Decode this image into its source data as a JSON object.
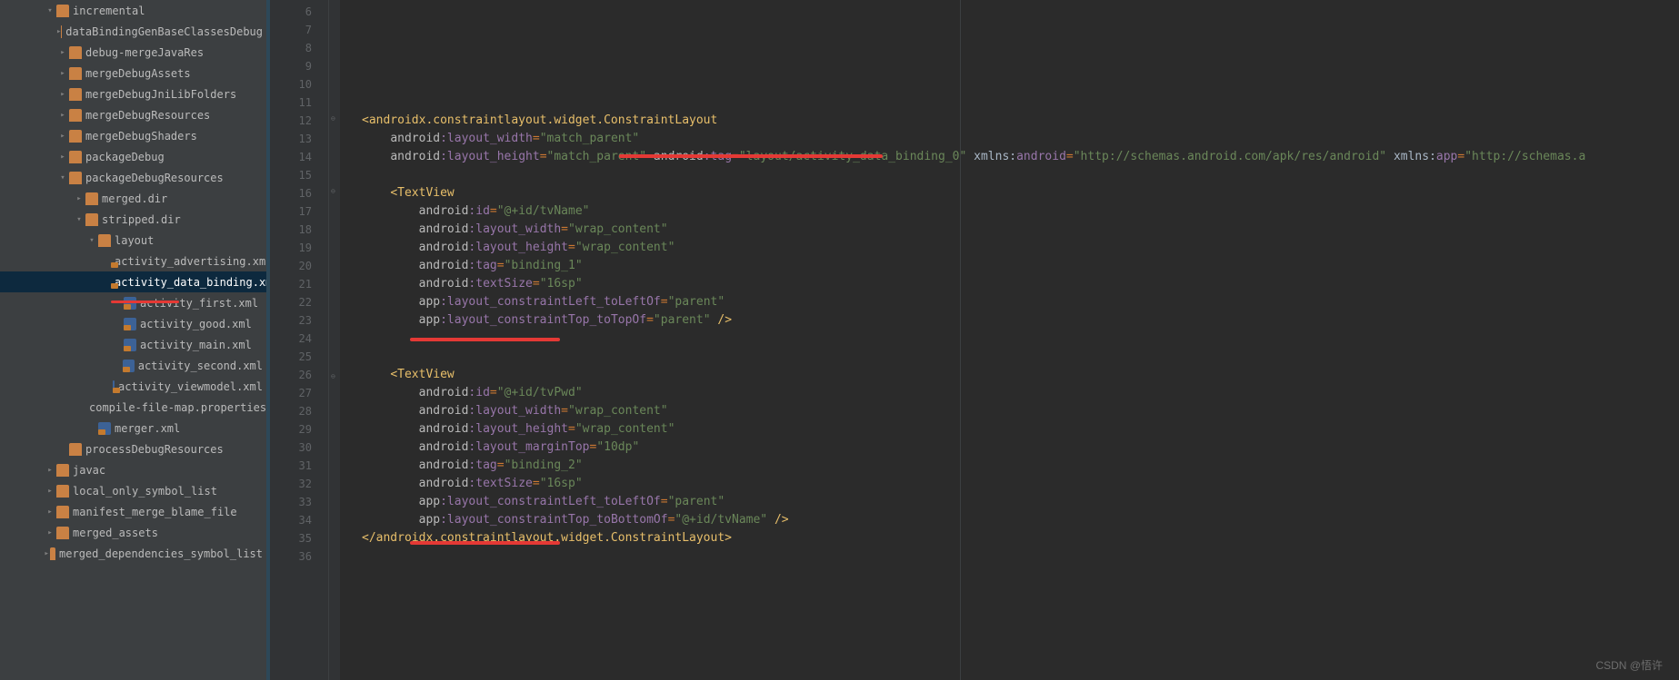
{
  "watermark": "CSDN @悟许",
  "tree": [
    {
      "indent": 48,
      "chevron": "down",
      "icon": "folder",
      "label": "incremental"
    },
    {
      "indent": 62,
      "chevron": "right",
      "icon": "folder",
      "label": "dataBindingGenBaseClassesDebug"
    },
    {
      "indent": 62,
      "chevron": "right",
      "icon": "folder",
      "label": "debug-mergeJavaRes"
    },
    {
      "indent": 62,
      "chevron": "right",
      "icon": "folder",
      "label": "mergeDebugAssets"
    },
    {
      "indent": 62,
      "chevron": "right",
      "icon": "folder",
      "label": "mergeDebugJniLibFolders"
    },
    {
      "indent": 62,
      "chevron": "right",
      "icon": "folder",
      "label": "mergeDebugResources"
    },
    {
      "indent": 62,
      "chevron": "right",
      "icon": "folder",
      "label": "mergeDebugShaders"
    },
    {
      "indent": 62,
      "chevron": "right",
      "icon": "folder",
      "label": "packageDebug"
    },
    {
      "indent": 62,
      "chevron": "down",
      "icon": "folder",
      "label": "packageDebugResources"
    },
    {
      "indent": 80,
      "chevron": "right",
      "icon": "folder",
      "label": "merged.dir"
    },
    {
      "indent": 80,
      "chevron": "down",
      "icon": "folder",
      "label": "stripped.dir"
    },
    {
      "indent": 94,
      "chevron": "down",
      "icon": "folder",
      "label": "layout"
    },
    {
      "indent": 122,
      "chevron": "",
      "icon": "file",
      "label": "activity_advertising.xml"
    },
    {
      "indent": 122,
      "chevron": "",
      "icon": "file",
      "label": "activity_data_binding.xml",
      "selected": true
    },
    {
      "indent": 122,
      "chevron": "",
      "icon": "file",
      "label": "activity_first.xml"
    },
    {
      "indent": 122,
      "chevron": "",
      "icon": "file",
      "label": "activity_good.xml"
    },
    {
      "indent": 122,
      "chevron": "",
      "icon": "file",
      "label": "activity_main.xml"
    },
    {
      "indent": 122,
      "chevron": "",
      "icon": "file",
      "label": "activity_second.xml"
    },
    {
      "indent": 122,
      "chevron": "",
      "icon": "file",
      "label": "activity_viewmodel.xml"
    },
    {
      "indent": 94,
      "chevron": "",
      "icon": "prop",
      "label": "compile-file-map.properties"
    },
    {
      "indent": 94,
      "chevron": "",
      "icon": "file",
      "label": "merger.xml"
    },
    {
      "indent": 62,
      "chevron": "",
      "icon": "folder",
      "label": "processDebugResources"
    },
    {
      "indent": 48,
      "chevron": "right",
      "icon": "folder",
      "label": "javac"
    },
    {
      "indent": 48,
      "chevron": "right",
      "icon": "folder",
      "label": "local_only_symbol_list"
    },
    {
      "indent": 48,
      "chevron": "right",
      "icon": "folder",
      "label": "manifest_merge_blame_file"
    },
    {
      "indent": 48,
      "chevron": "right",
      "icon": "folder",
      "label": "merged_assets"
    },
    {
      "indent": 48,
      "chevron": "right",
      "icon": "folder",
      "label": "merged_dependencies_symbol_list"
    }
  ],
  "line_numbers": [
    "6",
    "7",
    "8",
    "9",
    "10",
    "11",
    "12",
    "13",
    "14",
    "15",
    "16",
    "17",
    "18",
    "19",
    "20",
    "21",
    "22",
    "23",
    "24",
    "25",
    "26",
    "27",
    "28",
    "29",
    "30",
    "31",
    "32",
    "33",
    "34",
    "35",
    "36"
  ],
  "code": {
    "l12": {
      "tag_open": "<androidx.constraintlayout.widget.ConstraintLayout"
    },
    "l13": {
      "ns": "android",
      "attr": ":layout_width",
      "eq": "=",
      "val": "\"match_parent\""
    },
    "l14": {
      "ns": "android",
      "attr": ":layout_height",
      "eq": "=",
      "val": "\"match_parent\"",
      "sp": " ",
      "ns2": "android",
      "attr2": ":tag",
      "eq2": "=",
      "val2": "\"layout/activity_data_binding_0\"",
      "sp2": " ",
      "plain1": "xmlns:",
      "ns3": "android",
      "eq3": "=",
      "val3": "\"http://schemas.android.com/apk/res/android\"",
      "sp3": " ",
      "plain2": "xmlns:",
      "ns4": "app",
      "eq4": "=",
      "val4": "\"http://schemas.a"
    },
    "l16": {
      "tag_open": "<TextView"
    },
    "l17": {
      "ns": "android",
      "attr": ":id",
      "eq": "=",
      "val": "\"@+id/tvName\""
    },
    "l18": {
      "ns": "android",
      "attr": ":layout_width",
      "eq": "=",
      "val": "\"wrap_content\""
    },
    "l19": {
      "ns": "android",
      "attr": ":layout_height",
      "eq": "=",
      "val": "\"wrap_content\""
    },
    "l20": {
      "ns": "android",
      "attr": ":tag",
      "eq": "=",
      "val": "\"binding_1\""
    },
    "l21": {
      "ns": "android",
      "attr": ":textSize",
      "eq": "=",
      "val": "\"16sp\""
    },
    "l22": {
      "ns": "app",
      "attr": ":layout_constraintLeft_toLeftOf",
      "eq": "=",
      "val": "\"parent\""
    },
    "l23": {
      "ns": "app",
      "attr": ":layout_constraintTop_toTopOf",
      "eq": "=",
      "val": "\"parent\"",
      "close": " />"
    },
    "l26": {
      "tag_open": "<TextView"
    },
    "l27": {
      "ns": "android",
      "attr": ":id",
      "eq": "=",
      "val": "\"@+id/tvPwd\""
    },
    "l28": {
      "ns": "android",
      "attr": ":layout_width",
      "eq": "=",
      "val": "\"wrap_content\""
    },
    "l29": {
      "ns": "android",
      "attr": ":layout_height",
      "eq": "=",
      "val": "\"wrap_content\""
    },
    "l30": {
      "ns": "android",
      "attr": ":layout_marginTop",
      "eq": "=",
      "val": "\"10dp\""
    },
    "l31": {
      "ns": "android",
      "attr": ":tag",
      "eq": "=",
      "val": "\"binding_2\""
    },
    "l32": {
      "ns": "android",
      "attr": ":textSize",
      "eq": "=",
      "val": "\"16sp\""
    },
    "l33": {
      "ns": "app",
      "attr": ":layout_constraintLeft_toLeftOf",
      "eq": "=",
      "val": "\"parent\""
    },
    "l34": {
      "ns": "app",
      "attr": ":layout_constraintTop_toBottomOf",
      "eq": "=",
      "val": "\"@+id/tvName\"",
      "close": " />"
    },
    "l35": {
      "tag_close": "</androidx.constraintlayout.widget.ConstraintLayout>"
    }
  }
}
